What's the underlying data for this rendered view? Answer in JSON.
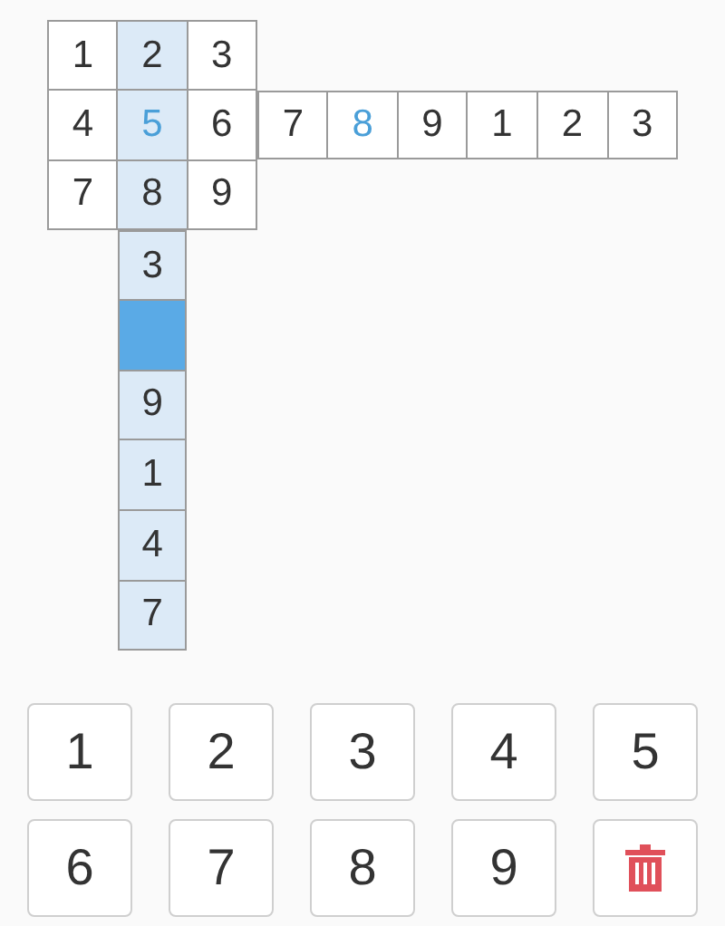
{
  "block": {
    "rows": [
      [
        {
          "value": "1",
          "kind": "given",
          "highlighted": false,
          "selected": false
        },
        {
          "value": "2",
          "kind": "given",
          "highlighted": true,
          "selected": false
        },
        {
          "value": "3",
          "kind": "given",
          "highlighted": false,
          "selected": false
        }
      ],
      [
        {
          "value": "4",
          "kind": "given",
          "highlighted": false,
          "selected": false
        },
        {
          "value": "5",
          "kind": "entered",
          "highlighted": true,
          "selected": false
        },
        {
          "value": "6",
          "kind": "given",
          "highlighted": false,
          "selected": false
        }
      ],
      [
        {
          "value": "7",
          "kind": "given",
          "highlighted": false,
          "selected": false
        },
        {
          "value": "8",
          "kind": "given",
          "highlighted": true,
          "selected": false
        },
        {
          "value": "9",
          "kind": "given",
          "highlighted": false,
          "selected": false
        }
      ]
    ]
  },
  "row_segments": [
    [
      {
        "value": "7",
        "kind": "given",
        "highlighted": false,
        "selected": false
      },
      {
        "value": "8",
        "kind": "entered",
        "highlighted": false,
        "selected": false
      },
      {
        "value": "9",
        "kind": "given",
        "highlighted": false,
        "selected": false
      }
    ],
    [
      {
        "value": "1",
        "kind": "given",
        "highlighted": false,
        "selected": false
      },
      {
        "value": "2",
        "kind": "given",
        "highlighted": false,
        "selected": false
      },
      {
        "value": "3",
        "kind": "given",
        "highlighted": false,
        "selected": false
      }
    ]
  ],
  "column_segments": [
    [
      {
        "value": "3",
        "kind": "given",
        "highlighted": true,
        "selected": false
      },
      {
        "kind": "empty",
        "highlighted": true,
        "selected": true
      },
      {
        "value": "9",
        "kind": "given",
        "highlighted": true,
        "selected": false
      }
    ],
    [
      {
        "value": "1",
        "kind": "given",
        "highlighted": true,
        "selected": false
      },
      {
        "value": "4",
        "kind": "given",
        "highlighted": true,
        "selected": false
      },
      {
        "value": "7",
        "kind": "given",
        "highlighted": true,
        "selected": false
      }
    ]
  ],
  "keypad": [
    {
      "kind": "digit",
      "label": "1"
    },
    {
      "kind": "digit",
      "label": "2"
    },
    {
      "kind": "digit",
      "label": "3"
    },
    {
      "kind": "digit",
      "label": "4"
    },
    {
      "kind": "digit",
      "label": "5"
    },
    {
      "kind": "digit",
      "label": "6"
    },
    {
      "kind": "digit",
      "label": "7"
    },
    {
      "kind": "digit",
      "label": "8"
    },
    {
      "kind": "digit",
      "label": "9"
    },
    {
      "kind": "delete"
    }
  ]
}
